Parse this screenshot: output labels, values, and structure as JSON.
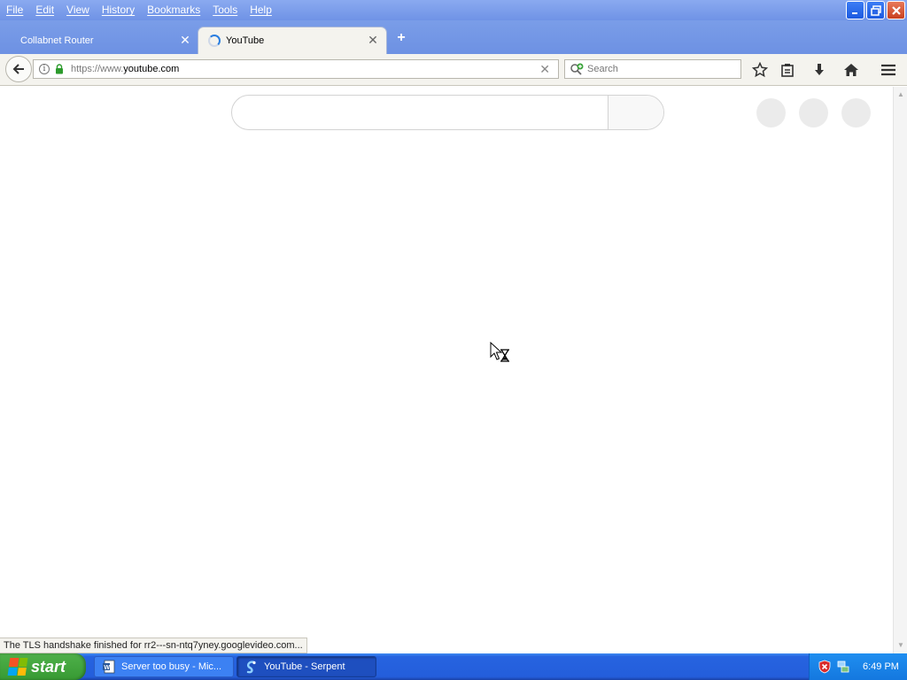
{
  "menubar": {
    "items": [
      "File",
      "Edit",
      "View",
      "History",
      "Bookmarks",
      "Tools",
      "Help"
    ]
  },
  "tabs": [
    {
      "label": "Collabnet Router",
      "active": false
    },
    {
      "label": "YouTube",
      "active": true,
      "loading": true
    }
  ],
  "navbar": {
    "url_prefix": "https://www.",
    "url_domain": "youtube.com",
    "search_placeholder": "Search"
  },
  "status_text": "The TLS handshake finished for rr2---sn-ntq7yney.googlevideo.com...",
  "taskbar": {
    "start_label": "start",
    "tasks": [
      {
        "label": "Server too busy - Mic...",
        "icon": "word-document-icon",
        "active": false
      },
      {
        "label": "YouTube - Serpent",
        "icon": "serpent-browser-icon",
        "active": true
      }
    ],
    "clock": "6:49 PM"
  },
  "colors": {
    "titlebar": "#7a9de8",
    "taskbar": "#245edb",
    "start": "#379a33"
  }
}
